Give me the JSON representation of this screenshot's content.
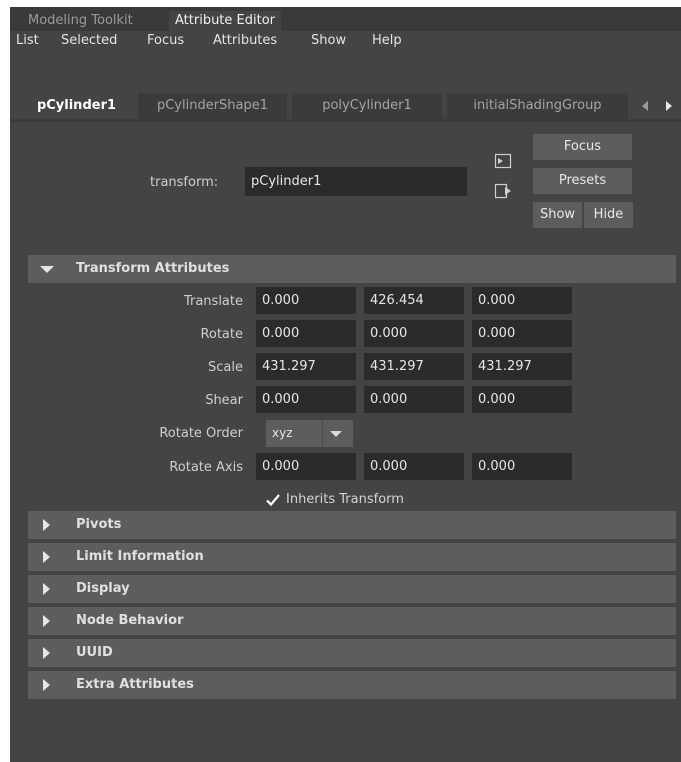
{
  "top_tabs": [
    "Modeling Toolkit",
    "Attribute Editor"
  ],
  "menu": [
    "List",
    "Selected",
    "Focus",
    "Attributes",
    "Show",
    "Help"
  ],
  "node_tabs": [
    "pCylinder1",
    "pCylinderShape1",
    "polyCylinder1",
    "initialShadingGroup"
  ],
  "transform": {
    "label": "transform:",
    "value": "pCylinder1"
  },
  "buttons": {
    "focus": "Focus",
    "presets": "Presets",
    "show": "Show",
    "hide": "Hide"
  },
  "transform_section": {
    "title": "Transform Attributes",
    "rows": [
      {
        "label": "Translate",
        "values": [
          "0.000",
          "426.454",
          "0.000"
        ]
      },
      {
        "label": "Rotate",
        "values": [
          "0.000",
          "0.000",
          "0.000"
        ]
      },
      {
        "label": "Scale",
        "values": [
          "431.297",
          "431.297",
          "431.297"
        ]
      },
      {
        "label": "Shear",
        "values": [
          "0.000",
          "0.000",
          "0.000"
        ]
      },
      {
        "label": "Rotate Order",
        "value": "xyz"
      },
      {
        "label": "Rotate Axis",
        "values": [
          "0.000",
          "0.000",
          "0.000"
        ]
      }
    ],
    "inherits_label": "Inherits Transform",
    "inherits_checked": true
  },
  "collapsed_sections": [
    "Pivots",
    "Limit Information",
    "Display",
    "Node Behavior",
    "UUID",
    "Extra Attributes"
  ],
  "colors": {
    "panel": "#444444",
    "field": "#2b2b2b",
    "header": "#5d5d5d",
    "tab_bg": "#3b3b3b"
  }
}
